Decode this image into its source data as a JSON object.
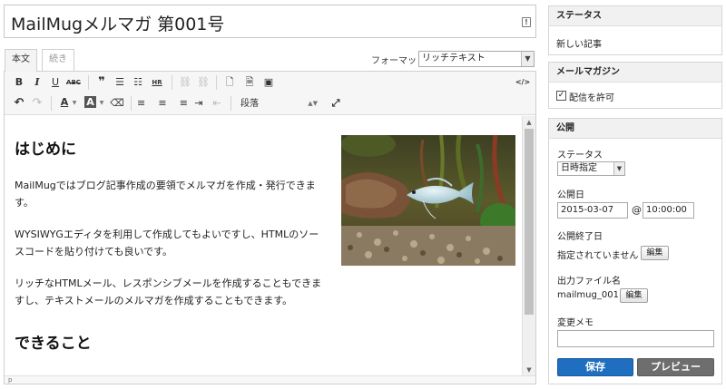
{
  "title": {
    "value": "MailMugメルマガ 第001号"
  },
  "tabs": [
    {
      "label": "本文"
    },
    {
      "label": "続き"
    }
  ],
  "format": {
    "label": "フォーマット:",
    "value": "リッチテキスト"
  },
  "toolbar": {
    "row1": [
      {
        "name": "bold-icon",
        "glyph": "B"
      },
      {
        "name": "italic-icon",
        "glyph": "I"
      },
      {
        "name": "underline-icon",
        "glyph": "U"
      },
      {
        "name": "strikethrough-icon",
        "glyph": "ABC"
      },
      {
        "name": "blockquote-icon",
        "glyph": "❞"
      },
      {
        "name": "bulleted-list-icon",
        "glyph": "☰"
      },
      {
        "name": "numbered-list-icon",
        "glyph": "☷"
      },
      {
        "name": "horizontal-rule-icon",
        "glyph": "HR"
      },
      {
        "name": "link-icon",
        "glyph": "⛓"
      },
      {
        "name": "unlink-icon",
        "glyph": "⛓"
      },
      {
        "name": "file-icon",
        "glyph": "🗋"
      },
      {
        "name": "insert-file-icon",
        "glyph": "🗎"
      },
      {
        "name": "image-icon",
        "glyph": "▣"
      },
      {
        "name": "source-code-icon",
        "glyph": "</>"
      }
    ],
    "row2": [
      {
        "name": "undo-icon",
        "glyph": "↶"
      },
      {
        "name": "redo-icon",
        "glyph": "↷"
      },
      {
        "name": "text-color-icon",
        "glyph": "A"
      },
      {
        "name": "background-color-icon",
        "glyph": "A"
      },
      {
        "name": "eraser-icon",
        "glyph": "⌫"
      },
      {
        "name": "align-left-icon",
        "glyph": "≡"
      },
      {
        "name": "align-center-icon",
        "glyph": "≡"
      },
      {
        "name": "align-right-icon",
        "glyph": "≡"
      },
      {
        "name": "indent-icon",
        "glyph": "⇥"
      },
      {
        "name": "outdent-icon",
        "glyph": "⇤"
      },
      {
        "name": "fullscreen-icon",
        "glyph": "⤢"
      }
    ],
    "paragraph_select": "段落"
  },
  "content": {
    "heading1": "はじめに",
    "p1": "MailMugではブログ記事作成の要領でメルマガを作成・発行できます。",
    "p2": "WYSIWYGエディタを利用して作成してもよいですし、HTMLのソースコードを貼り付けても良いです。",
    "p3": "リッチなHTMLメール、レスポンシブメールを作成することもできますし、テキストメールのメルマガを作成することもできます。",
    "heading2": "できること",
    "image_alt": "fish-photo"
  },
  "statusbar": {
    "path": "p"
  },
  "sidebar": {
    "status_box": {
      "title": "ステータス",
      "value": "新しい記事"
    },
    "mag_box": {
      "title": "メールマガジン",
      "checkbox_label": "配信を許可",
      "checked": true
    },
    "publish_box": {
      "title": "公開",
      "status_label": "ステータス",
      "status_value": "日時指定",
      "date_label": "公開日",
      "date_value": "2015-03-07",
      "at": "@",
      "time_value": "10:00:00",
      "end_label": "公開終了日",
      "end_value": "指定されていません",
      "edit_label": "編集",
      "file_label": "出力ファイル名",
      "file_value": "mailmug_001",
      "memo_label": "変更メモ",
      "memo_value": "",
      "save_label": "保存",
      "preview_label": "プレビュー"
    }
  },
  "colors": {
    "primary": "#1f6ebf",
    "secondary": "#6e6e6e"
  }
}
